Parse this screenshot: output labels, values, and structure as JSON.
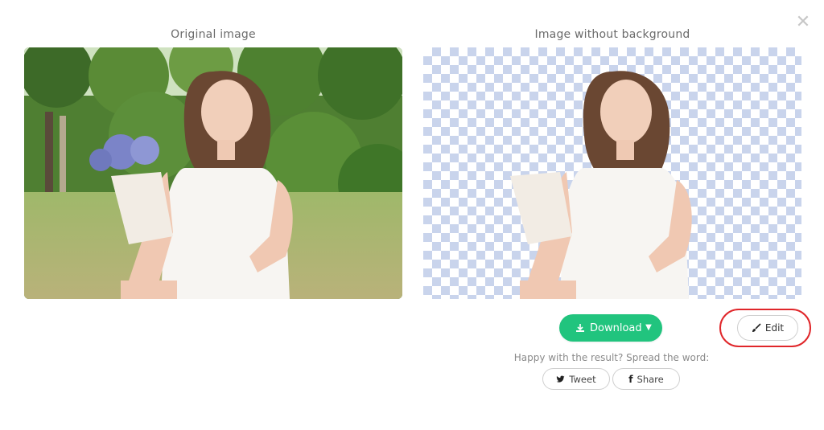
{
  "dialog": {
    "close_icon": "close-icon",
    "original_caption": "Original image",
    "result_caption": "Image without background"
  },
  "actions": {
    "download_label": "Download",
    "download_icon": "download-icon",
    "dropdown_icon": "caret-down-icon",
    "edit_label": "Edit",
    "edit_icon": "brush-icon",
    "highlight_color": "#e0262a",
    "accent_color": "#21c47e"
  },
  "share": {
    "prompt": "Happy with the result? Spread the word:",
    "tweet_label": "Tweet",
    "tweet_icon": "twitter-icon",
    "share_label": "Share",
    "share_icon": "facebook-icon"
  }
}
